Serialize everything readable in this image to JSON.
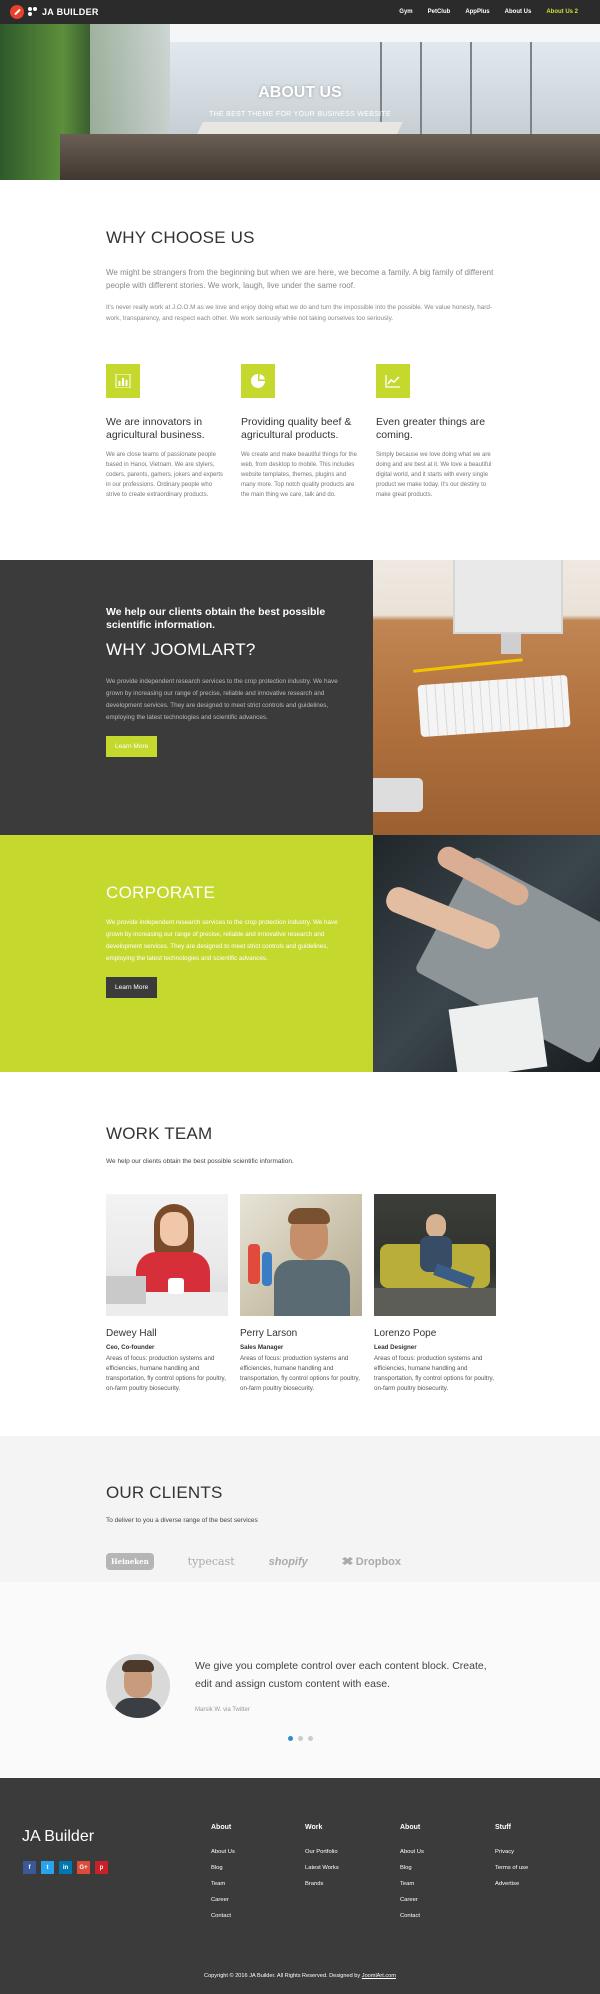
{
  "nav": {
    "brand": "JA BUILDER",
    "items": [
      "Gym",
      "PetClub",
      "AppPlus",
      "About Us",
      "About Us 2"
    ],
    "accent": "#d2df3c"
  },
  "hero": {
    "title": "ABOUT US",
    "subtitle": "THE BEST THEME FOR YOUR BUSINESS WEBSITE"
  },
  "why": {
    "title": "WHY CHOOSE US",
    "lead": "We might be strangers from the beginning but when we are here, we become a family. A big family of different people with different stories. We work, laugh, live under the same roof.",
    "paragraph": "It's never really work at J.O.O.M as we love and enjoy doing what we do and turn the impossible into the possible. We value honesty, hard-work, transparency, and respect each other. We work seriously while not taking ourselves too seriously.",
    "features": [
      {
        "icon": "bar-chart-icon",
        "title": "We are innovators in agricultural business.",
        "text": "We are close teams of passionate people based in Hanoi, Vietnam. We are stylers, coders, parents, gamers, jokers and experts in our professions. Ordinary people who strive to create extraordinary products."
      },
      {
        "icon": "pie-chart-icon",
        "title": "Providing quality beef & agricultural products.",
        "text": "We create and make beautiful things for the web, from desktop to mobile. This includes website templates, themes, plugins and many more. Top notch quality products are the main thing we care, talk and do."
      },
      {
        "icon": "line-chart-icon",
        "title": "Even greater things are coming.",
        "text": "Simply because we love doing what we are doing and are best at it. We love a beautiful digital world, and it starts with every single product we make today. It's our destiny to make great products."
      }
    ]
  },
  "joomlart": {
    "kicker": "We help our clients obtain the best possible scientific information.",
    "title": "WHY JOOMLART?",
    "text": "We provide independent research services to the crop protection industry. We have grown by increasing our range of precise, reliable and innovative research and development services. They are designed to meet strict controls and guidelines, employing the latest technologies and scientific advances.",
    "button": "Learn More"
  },
  "corporate": {
    "title": "CORPORATE",
    "text": "We provide independent research services to the crop protection industry. We have grown by increasing our range of precise, reliable and innovative research and development services. They are designed to meet strict controls and guidelines, employing the latest technologies and scientific advances.",
    "button": "Learn More"
  },
  "team": {
    "title": "WORK TEAM",
    "subtitle": "We help our clients obtain the best possible scientific information.",
    "members": [
      {
        "name": "Dewey Hall",
        "role": "Ceo, Co-founder",
        "text": "Areas of focus: production systems and efficiencies, humane handling and transportation, fly control options for poultry, on-farm poultry biosecurity."
      },
      {
        "name": "Perry Larson",
        "role": "Sales Manager",
        "text": "Areas of focus: production systems and efficiencies, humane handling and transportation, fly control options for poultry, on-farm poultry biosecurity."
      },
      {
        "name": "Lorenzo Pope",
        "role": "Lead Designer",
        "text": "Areas of focus: production systems and efficiencies, humane handling and transportation, fly control options for poultry, on-farm poultry biosecurity."
      }
    ]
  },
  "clients": {
    "title": "OUR CLIENTS",
    "subtitle": "To deliver to you a diverse range of the best services",
    "logos": [
      "Heineken",
      "typecast",
      "shopify",
      "Dropbox"
    ]
  },
  "testimonial": {
    "quote": "We give you complete control over each content block. Create, edit and assign custom content with ease.",
    "cite": "Marsik W. via Twitter"
  },
  "footer": {
    "brand": "JA Builder",
    "social": [
      "f",
      "t",
      "in",
      "G+",
      "p"
    ],
    "social_colors": [
      "#3b5998",
      "#2aa3ef",
      "#0077b5",
      "#dd4b39",
      "#cb2027"
    ],
    "columns": [
      {
        "title": "About",
        "links": [
          "About Us",
          "Blog",
          "Team",
          "Career",
          "Contact"
        ]
      },
      {
        "title": "Work",
        "links": [
          "Our Portfolio",
          "Latest Works",
          "Brands"
        ]
      },
      {
        "title": "About",
        "links": [
          "About Us",
          "Blog",
          "Team",
          "Career",
          "Contact"
        ]
      },
      {
        "title": "Stuff",
        "links": [
          "Privacy",
          "Terms of use",
          "Advertise"
        ]
      }
    ],
    "copyright": "Copyright © 2016 JA Builder. All Rights Reserved. Designed by",
    "copyright_link": "JoomlArt.com"
  }
}
